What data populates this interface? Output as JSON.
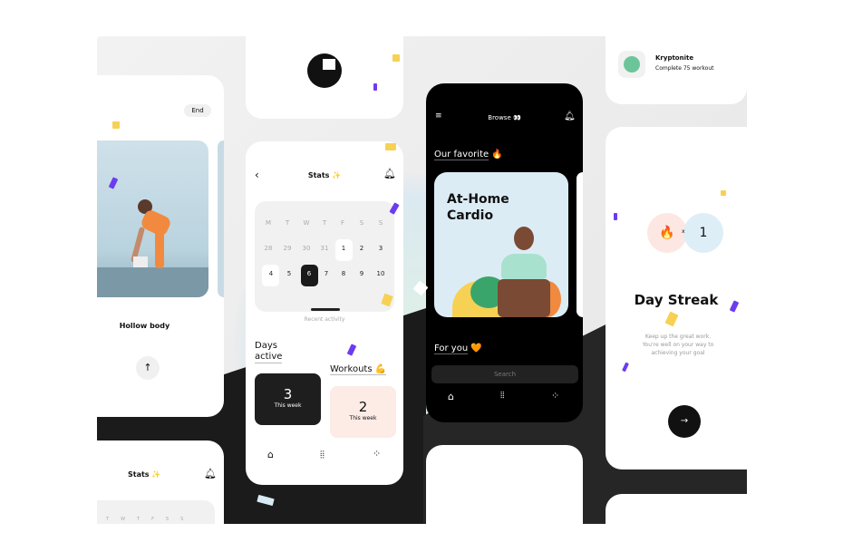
{
  "workout_screen": {
    "end_label": "End",
    "exercise": "Hollow body",
    "up_button": "arrow-up-icon"
  },
  "stats_screen": {
    "title": "Stats",
    "title_emoji": "✨",
    "weekdays": [
      "M",
      "T",
      "W",
      "T",
      "F",
      "S",
      "S"
    ],
    "week1": [
      "28",
      "29",
      "30",
      "31",
      "1",
      "2",
      "3"
    ],
    "week2": [
      "4",
      "5",
      "6",
      "7",
      "8",
      "9",
      "10"
    ],
    "selected_day": "6",
    "recent_activity": "Recent activity",
    "days_active_title_1": "Days",
    "days_active_title_2": "active",
    "days_active_value": "3",
    "days_active_caption": "This week",
    "workouts_title": "Workouts",
    "workouts_emoji": "💪",
    "workouts_value": "2",
    "workouts_caption": "This week"
  },
  "browse_screen": {
    "title": "Browse",
    "title_emoji": "👀",
    "our_favorite": "Our favorite",
    "favorite_emoji": "🔥",
    "card_title_1": "At-Home",
    "card_title_2": "Cardio",
    "for_you": "For you",
    "for_you_emoji": "🧡",
    "search_placeholder": "Search"
  },
  "achievement": {
    "title": "Kryptonite",
    "subtitle": "Complete 75 workout"
  },
  "streak_screen": {
    "fire_emoji": "🔥",
    "multiplier": "x",
    "count": "1",
    "title": "Day Streak",
    "message": "Keep up the great work. You're well on your way to achieving your goal"
  },
  "stats_preview": {
    "title": "Stats",
    "title_emoji": "✨",
    "weekdays": [
      "T",
      "W",
      "T",
      "F",
      "S",
      "S"
    ]
  },
  "colors": {
    "accent_purple": "#6b3cf0",
    "confetti_yellow": "#f7d154",
    "streak_pink": "#fde7e2",
    "streak_blue": "#ddeef7",
    "kryptonite_green": "#6cc59a",
    "workouts_bg": "#fdebe6"
  }
}
